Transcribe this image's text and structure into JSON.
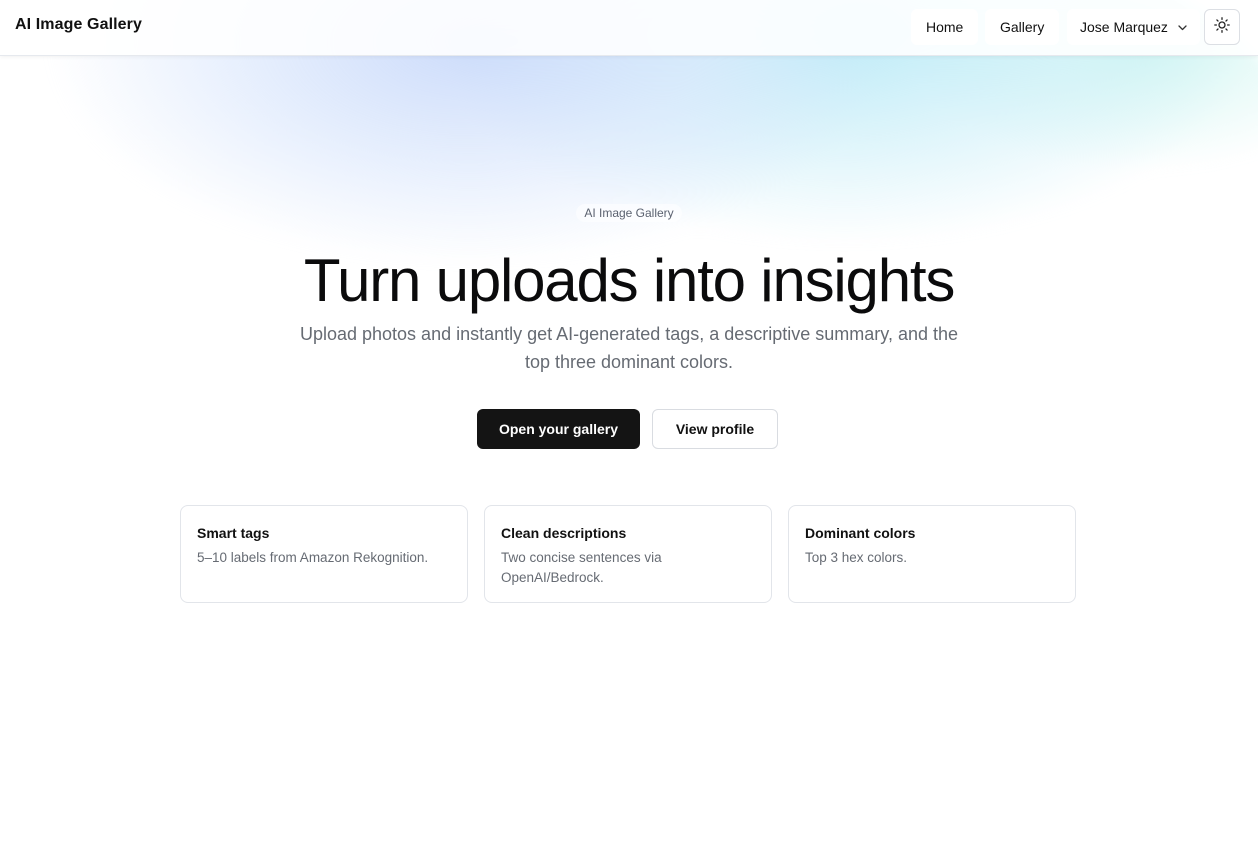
{
  "header": {
    "brand": "AI Image Gallery",
    "nav": {
      "home": "Home",
      "gallery": "Gallery",
      "user": "Jose Marquez"
    },
    "theme_toggle_icon": "sun-icon",
    "user_menu_icon": "chevron-down-icon"
  },
  "hero": {
    "eyebrow": "AI Image Gallery",
    "title": "Turn uploads into insights",
    "subtitle": "Upload photos and instantly get AI-generated tags, a descriptive summary, and the top three dominant colors.",
    "primary_cta": "Open your gallery",
    "secondary_cta": "View profile"
  },
  "features": [
    {
      "title": "Smart tags",
      "text": "5–10 labels from Amazon Rekognition."
    },
    {
      "title": "Clean descriptions",
      "text": "Two concise sentences via OpenAI/Bedrock."
    },
    {
      "title": "Dominant colors",
      "text": "Top 3 hex colors."
    }
  ],
  "colors": {
    "primary_button": "#141414",
    "text_muted": "#666b73",
    "glow_blue": "#c4d6fa",
    "glow_cyan": "#b2e8f6"
  }
}
